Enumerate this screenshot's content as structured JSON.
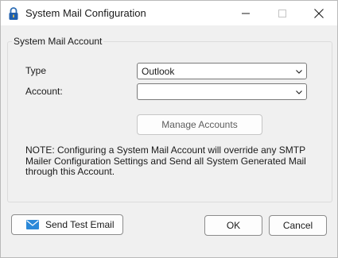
{
  "window": {
    "title": "System Mail Configuration",
    "title_icon": "padlock-icon"
  },
  "caption_buttons": {
    "minimize_icon": "minimize-icon",
    "maximize_icon": "maximize-icon",
    "close_icon": "close-icon"
  },
  "group": {
    "label": "System Mail Account"
  },
  "form": {
    "type_label": "Type",
    "type_value": "Outlook",
    "account_label": "Account:",
    "account_value": ""
  },
  "buttons": {
    "manage_accounts": "Manage Accounts",
    "send_test_email": "Send Test Email",
    "ok": "OK",
    "cancel": "Cancel"
  },
  "note": "NOTE:  Configuring a System Mail Account will override any SMTP Mailer Configuration Settings and Send all System Generated Mail through this Account.",
  "colors": {
    "accent": "#2b88d8",
    "window_bg": "#f0f0f0",
    "titlebar_bg": "#ffffff"
  }
}
